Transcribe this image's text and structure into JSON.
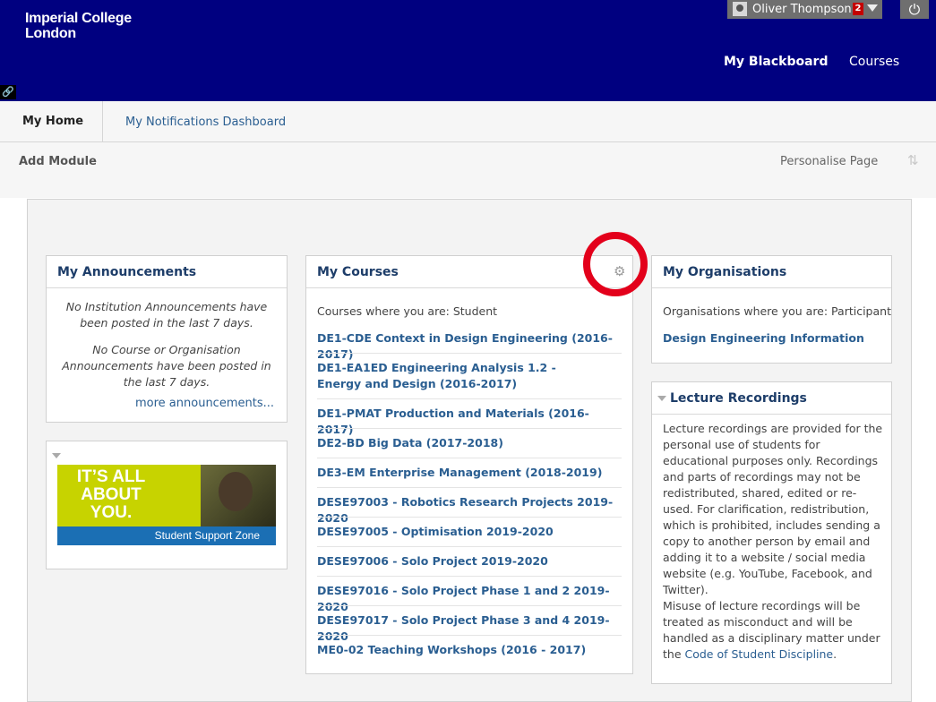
{
  "header": {
    "logo_line1": "Imperial College",
    "logo_line2": "London",
    "user_name": "Oliver Thompson",
    "notification_count": "2",
    "nav": [
      "My Blackboard",
      "Courses"
    ],
    "background_color": "#000080"
  },
  "tabs": [
    "My Home",
    "My Notifications Dashboard"
  ],
  "actions": {
    "add_module": "Add Module",
    "personalise_page": "Personalise Page"
  },
  "announcements": {
    "title": "My Announcements",
    "institution_msg": "No Institution Announcements have been posted in the last 7 days.",
    "course_msg": "No Course or Organisation Announcements have been posted in the last 7 days.",
    "more_link": "more announcements..."
  },
  "banner": {
    "line1": "IT’S ALL",
    "line2": "ABOUT",
    "line3": "YOU.",
    "footer": "Student Support Zone"
  },
  "courses": {
    "title": "My Courses",
    "role_label": "Courses where you are: Student",
    "items": [
      "DE1-CDE Context in Design Engineering (2016-2017)",
      "DE1-EA1ED Engineering Analysis 1.2 - Energy and Design (2016-2017)",
      "DE1-PMAT Production and Materials (2016-2017)",
      "DE2-BD Big Data (2017-2018)",
      "DE3-EM Enterprise Management (2018-2019)",
      "DESE97003 - Robotics Research Projects 2019-2020",
      "DESE97005 - Optimisation 2019-2020",
      "DESE97006 - Solo Project 2019-2020",
      "DESE97016 - Solo Project Phase 1 and 2 2019-2020",
      "DESE97017 - Solo Project Phase 3 and 4 2019-2020",
      "ME0-02 Teaching Workshops (2016 - 2017)"
    ]
  },
  "organisations": {
    "title": "My Organisations",
    "role_label": "Organisations where you are: Participant",
    "items": [
      "Design Engineering Information"
    ]
  },
  "lecture_recordings": {
    "title": "Lecture Recordings",
    "para1": "Lecture recordings are provided for the personal use of students for educational purposes only. Recordings and parts of recordings may not be redistributed, shared, edited or re-used. For clarification, redistribution, which is prohibited, includes sending a copy to another person by email and adding it to a website / social media website (e.g. YouTube, Facebook, and Twitter).",
    "para2_prefix": "Misuse of lecture recordings will be treated as misconduct and will be handled as a disciplinary matter under the ",
    "para2_link": "Code of Student Discipline",
    "para2_suffix": "."
  },
  "colors": {
    "link": "#2a5e91",
    "highlight_circle": "#e3001b"
  }
}
